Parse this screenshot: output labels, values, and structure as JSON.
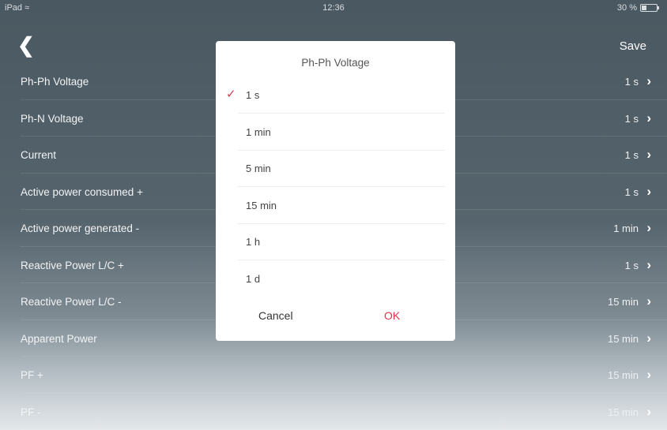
{
  "status_bar": {
    "device": "iPad",
    "time": "12:36",
    "battery": "30 %"
  },
  "nav": {
    "title": "",
    "save_label": "Save"
  },
  "rows": [
    {
      "label": "Ph-Ph Voltage",
      "value": "1 s"
    },
    {
      "label": "Ph-N Voltage",
      "value": "1 s"
    },
    {
      "label": "Current",
      "value": "1 s"
    },
    {
      "label": "Active power consumed +",
      "value": "1 s"
    },
    {
      "label": "Active power generated -",
      "value": "1 min"
    },
    {
      "label": "Reactive Power L/C +",
      "value": "1 s"
    },
    {
      "label": "Reactive Power L/C -",
      "value": "15 min"
    },
    {
      "label": "Apparent Power",
      "value": "15 min"
    },
    {
      "label": "PF +",
      "value": "15 min"
    },
    {
      "label": "PF -",
      "value": "15 min"
    }
  ],
  "dialog": {
    "title": "Ph-Ph Voltage",
    "options": [
      {
        "label": "1 s",
        "selected": true
      },
      {
        "label": "1 min",
        "selected": false
      },
      {
        "label": "5 min",
        "selected": false
      },
      {
        "label": "15 min",
        "selected": false
      },
      {
        "label": "1 h",
        "selected": false
      },
      {
        "label": "1 d",
        "selected": false
      }
    ],
    "cancel_label": "Cancel",
    "ok_label": "OK"
  },
  "colors": {
    "accent": "#e0334a",
    "check": "#d23b4f"
  },
  "icons": {
    "back": "chevron-left-icon",
    "row": "chevron-right-icon",
    "selected": "checkmark-icon",
    "wifi": "wifi-icon",
    "battery": "battery-icon"
  }
}
